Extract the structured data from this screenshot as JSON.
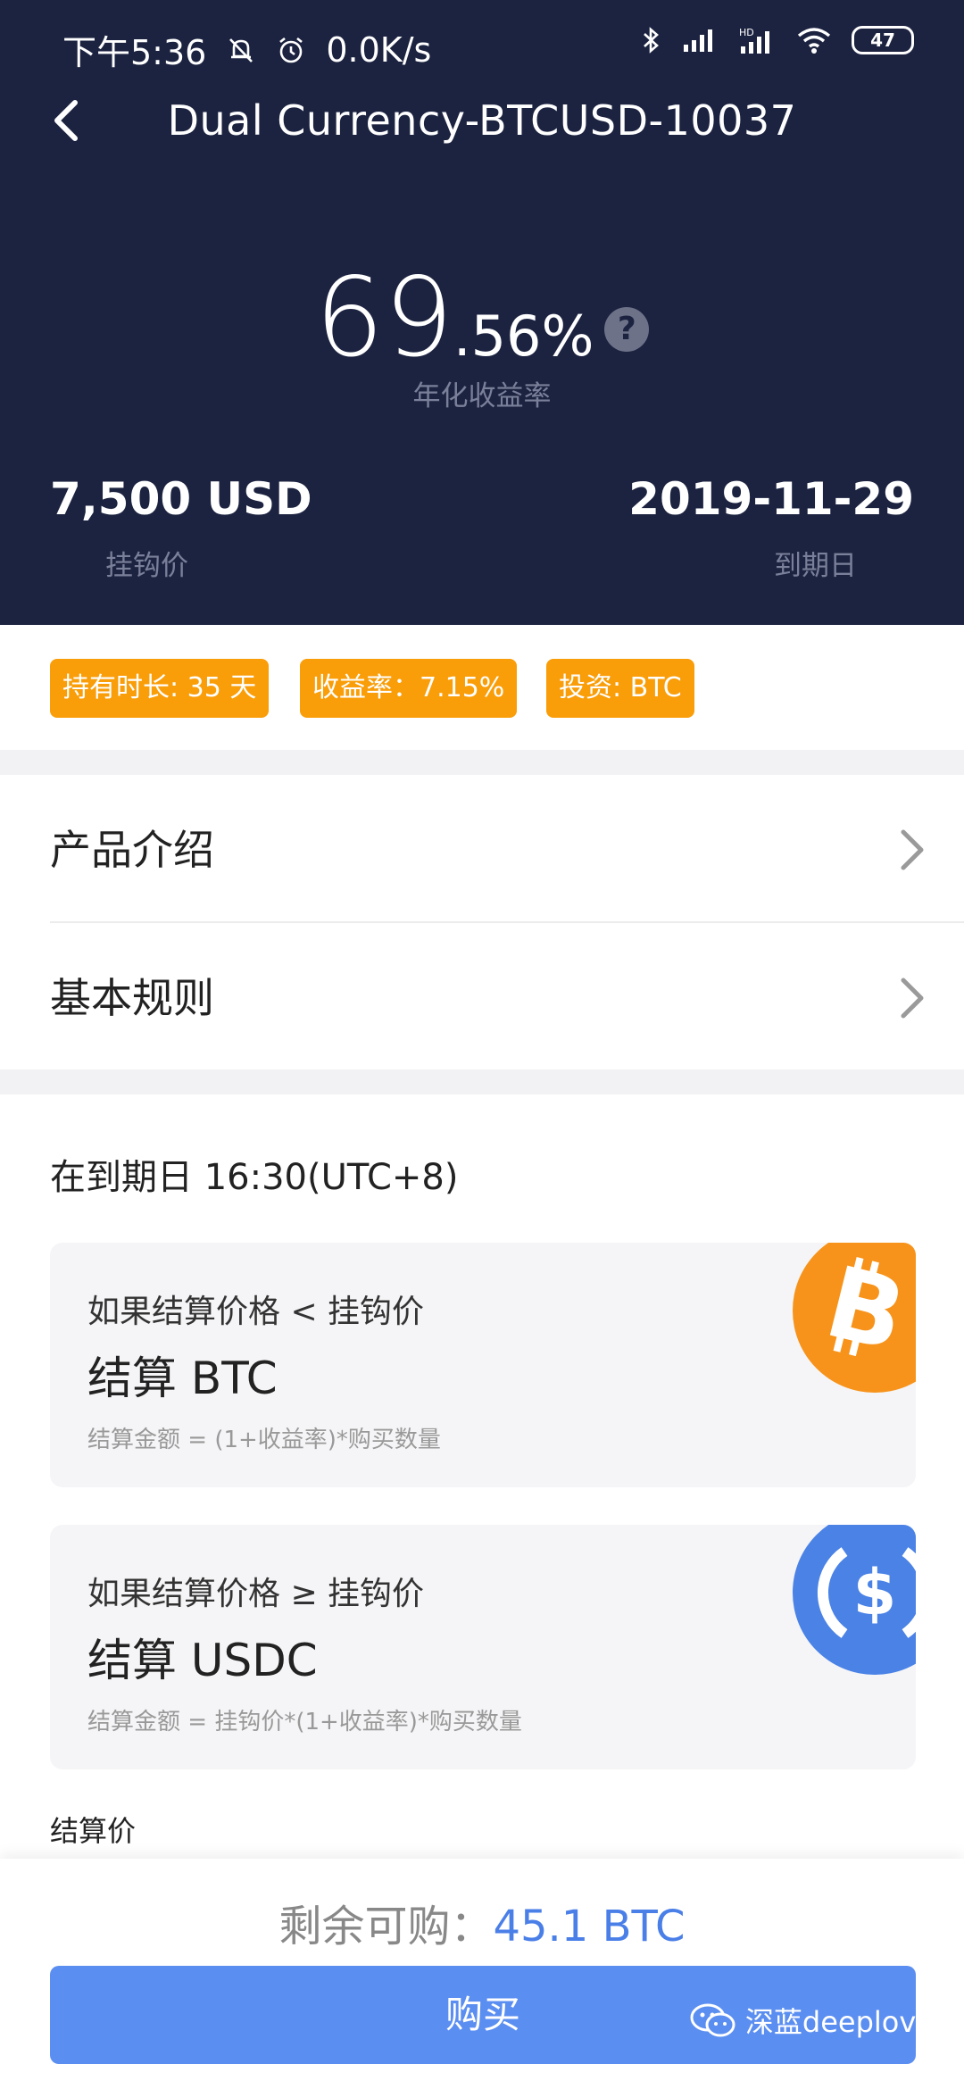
{
  "status_bar": {
    "time": "下午5:36",
    "net_speed": "0.0K/s",
    "battery": "47",
    "hd_label": "HD"
  },
  "header": {
    "title": "Dual Currency-BTCUSD-10037",
    "rate_int": "69",
    "rate_dec": ".56%",
    "help_symbol": "?",
    "rate_label": "年化收益率",
    "strike_value": "7,500 USD",
    "strike_label": "挂钩价",
    "expiry_value": "2019-11-29",
    "expiry_label": "到期日"
  },
  "tags": [
    {
      "label": "持有时长: 35 天"
    },
    {
      "label": "收益率：7.15%"
    },
    {
      "label": "投资: BTC"
    }
  ],
  "menu": [
    {
      "label": "产品介绍"
    },
    {
      "label": "基本规则"
    }
  ],
  "settlement": {
    "heading": "在到期日 16:30(UTC+8)",
    "cards": [
      {
        "condition": "如果结算价格 < 挂钩价",
        "result": "结算 BTC",
        "formula": "结算金额 = (1+收益率)*购买数量",
        "coin_icon": "bitcoin-icon",
        "coin_color": "#f7931a"
      },
      {
        "condition": "如果结算价格 ≥ 挂钩价",
        "result": "结算 USDC",
        "formula": "结算金额 = 挂钩价*(1+收益率)*购买数量",
        "coin_icon": "usdc-icon",
        "coin_color": "#4a82e6"
      }
    ],
    "settle_price_label": "结算价"
  },
  "footer": {
    "remain_label": "剩余可购：",
    "remain_value": "45.1 BTC",
    "buy_label": "购买",
    "watermark": "深蓝deeplove"
  },
  "colors": {
    "header_bg": "#1c2340",
    "tag_bg": "#f99d08",
    "button": "#5b8ef1",
    "accent_text": "#4a7fe8"
  }
}
